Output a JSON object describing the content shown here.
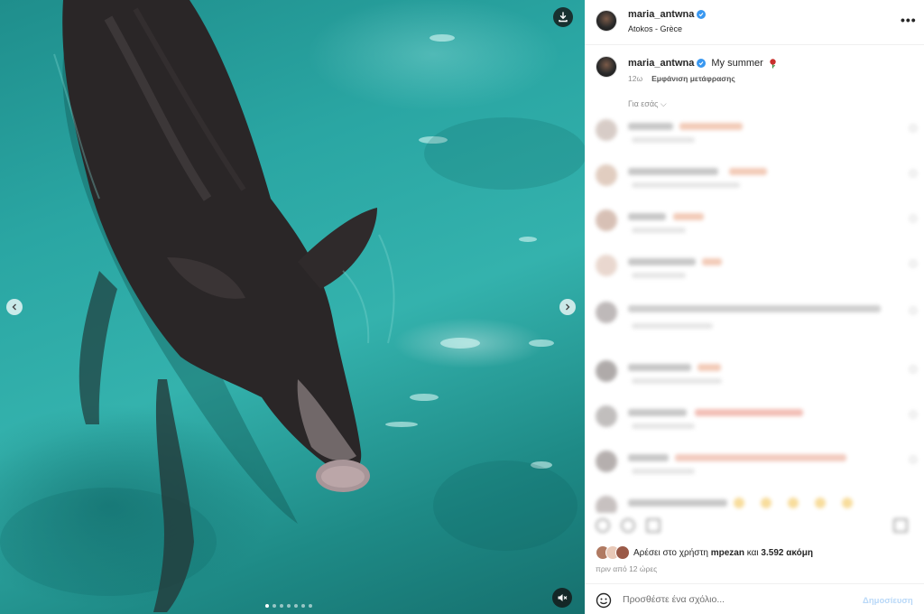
{
  "post": {
    "username": "maria_antwna",
    "location": "Atokos - Grèce",
    "caption": "My summer",
    "caption_emoji": "rose",
    "age": "12ω",
    "translate_label": "Εμφάνιση μετάφρασης",
    "for_you_label": "Για εσάς ⌵",
    "more_label": "•••"
  },
  "likes": {
    "prefix": "Αρέσει στο χρήστη",
    "user": "mpezan",
    "middle": "και",
    "count": "3.592 ακόμη",
    "time_ago": "πριν από 12 ώρες"
  },
  "comment_box": {
    "placeholder": "Προσθέστε ένα σχόλιο...",
    "publish_label": "Δημοσίευση"
  },
  "media": {
    "slide_count": 7,
    "active_slide": 0,
    "icons": [
      "download-icon",
      "mute-icon",
      "chevron-left-icon",
      "chevron-right-icon"
    ]
  },
  "colors": {
    "verified": "#3897f0",
    "water": "#2aa6a3",
    "publish": "#b8d8f8"
  }
}
